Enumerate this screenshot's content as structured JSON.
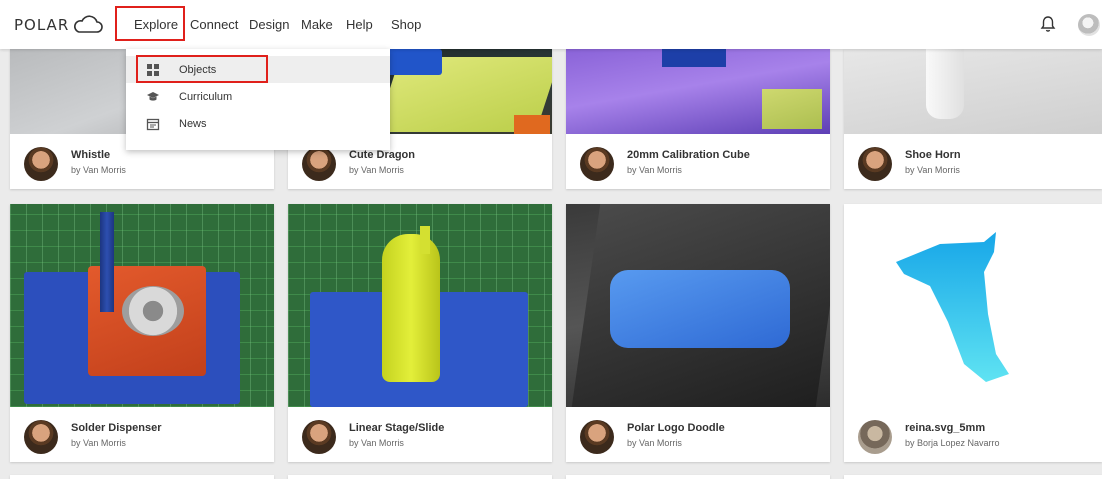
{
  "brand": {
    "name": "POLAR"
  },
  "nav": {
    "items": [
      {
        "label": "Explore"
      },
      {
        "label": "Connect"
      },
      {
        "label": "Design"
      },
      {
        "label": "Make"
      },
      {
        "label": "Help"
      },
      {
        "label": "Shop"
      }
    ]
  },
  "dropdown": {
    "items": [
      {
        "label": "Objects",
        "icon": "grid-icon"
      },
      {
        "label": "Curriculum",
        "icon": "graduation-cap-icon"
      },
      {
        "label": "News",
        "icon": "calendar-icon"
      }
    ]
  },
  "header_icons": {
    "notifications": "bell-icon",
    "user": "avatar"
  },
  "colors": {
    "highlight": "#e0201b",
    "background": "#ebebeb"
  },
  "cards": [
    {
      "title": "Whistle",
      "author": "by Van Morris"
    },
    {
      "title": "Cute Dragon",
      "author": "by Van Morris"
    },
    {
      "title": "20mm Calibration Cube",
      "author": "by Van Morris"
    },
    {
      "title": "Shoe Horn",
      "author": "by Van Morris"
    },
    {
      "title": "Solder Dispenser",
      "author": "by Van Morris"
    },
    {
      "title": "Linear Stage/Slide",
      "author": "by Van Morris"
    },
    {
      "title": "Polar Logo Doodle",
      "author": "by Van Morris"
    },
    {
      "title": "reina.svg_5mm",
      "author": "by Borja Lopez Navarro"
    }
  ]
}
